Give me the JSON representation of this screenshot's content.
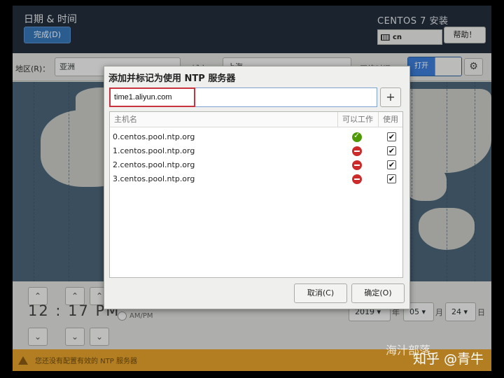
{
  "header": {
    "page_title": "日期 & 时间",
    "done_label": "完成(D)",
    "install_title": "CENTOS 7 安装",
    "keyboard_layout": "cn",
    "help_label": "帮助！"
  },
  "region_bar": {
    "region_label": "地区(R)：",
    "region_value": "亚洲",
    "city_label": "城市(C)：",
    "city_value": "上海",
    "network_time_label": "网络时间(N)：",
    "switch_on_label": "打开"
  },
  "time": {
    "clock": "12 : 17 PM",
    "ampm_label": "AM/PM",
    "year": "2019",
    "year_unit": "年",
    "month": "05",
    "month_unit": "月",
    "day": "24",
    "day_unit": "日"
  },
  "warning": {
    "text": "您还没有配置有效的 NTP 服务器"
  },
  "dialog": {
    "title": "添加并标记为使用 NTP 服务器",
    "input_value": "time1.aliyun.com",
    "add_label": "+",
    "columns": {
      "host": "主机名",
      "working": "可以工作",
      "use": "使用"
    },
    "servers": [
      {
        "host": "0.centos.pool.ntp.org",
        "working": true,
        "use": true
      },
      {
        "host": "1.centos.pool.ntp.org",
        "working": false,
        "use": true
      },
      {
        "host": "2.centos.pool.ntp.org",
        "working": false,
        "use": true
      },
      {
        "host": "3.centos.pool.ntp.org",
        "working": false,
        "use": true
      }
    ],
    "cancel_label": "取消(C)",
    "ok_label": "确定(O)"
  },
  "watermark": {
    "line1": "海汁部落",
    "line2": "知乎 @青牛"
  },
  "colors": {
    "header_bg": "#232d3b",
    "accent_blue": "#3876b8",
    "warning_bg": "#e5a22b",
    "ok_green": "#4e9a06",
    "error_red": "#cc2b2b",
    "highlight_red": "#c8333d"
  }
}
